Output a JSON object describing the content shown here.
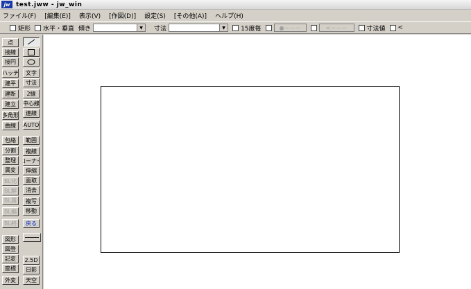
{
  "window": {
    "app_icon": "jw",
    "title": "test.jww - jw_win"
  },
  "menu": [
    "ファイル(F)",
    "[編集(E)]",
    "表示(V)",
    "[作図(D)]",
    "設定(S)",
    "[その他(A)]",
    "ヘルプ(H)"
  ],
  "toolbar": {
    "rect_label": "矩形",
    "hv_label": "水平・垂直",
    "angle_label": "傾き",
    "angle_value": "",
    "dim_label": "寸法",
    "dim_value": "",
    "snap15_label": "15度毎",
    "slider1_label": "●－－－",
    "slider2_label": "<－－－",
    "dimval_label": "寸法値",
    "arrow_label": "<"
  },
  "sidebar": {
    "left": [
      "点",
      "接線",
      "接円",
      "ハッチ",
      "建平",
      "建断",
      "建立",
      "多角形",
      "曲線",
      "包絡",
      "分割",
      "整理",
      "属変",
      "BL化",
      "BL解",
      "BL属",
      "BL編",
      "BL終",
      "図形",
      "図登",
      "記変",
      "座標",
      "外変"
    ],
    "right": [
      "／",
      "□",
      "○",
      "文字",
      "寸法",
      "2線",
      "中心線",
      "連線",
      "AUTO",
      "範囲",
      "複線",
      "コーナー",
      "伸縮",
      "面取",
      "消去",
      "複写",
      "移動",
      "戻る",
      "",
      "2.5D",
      "日影",
      "天空"
    ],
    "disabled_left": [
      "BL化",
      "BL解",
      "BL属",
      "BL編",
      "BL終"
    ]
  }
}
